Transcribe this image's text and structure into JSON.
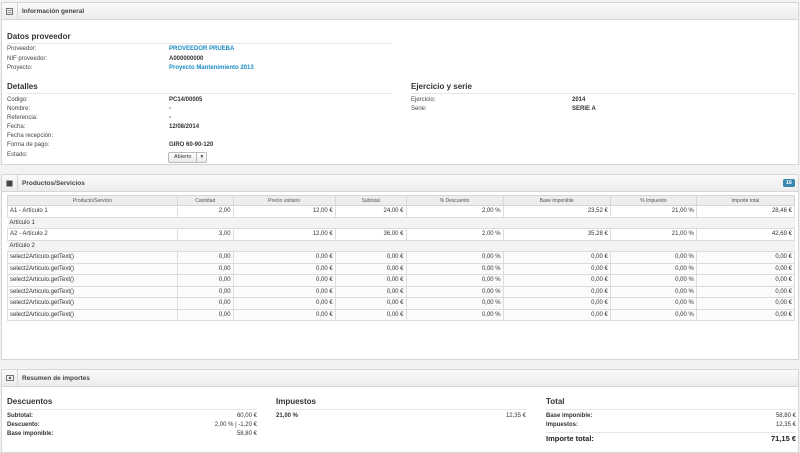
{
  "general": {
    "title": "Información general",
    "proveedor_section": "Datos proveedor",
    "proveedor_label": "Proveedor:",
    "proveedor_value": "PROVEEDOR PRUEBA",
    "nif_label": "NIF proveedor:",
    "nif_value": "A000000000",
    "proyecto_label": "Proyecto:",
    "proyecto_value": "Proyecto Mantenimiento 2013",
    "detalles_section": "Detalles",
    "codigo_label": "Codigo:",
    "codigo_value": "PC14/00005",
    "nombre_label": "Nombre:",
    "nombre_value": "-",
    "referencia_label": "Referencia:",
    "referencia_value": "-",
    "fecha_label": "Fecha:",
    "fecha_value": "12/08/2014",
    "fecha_recepcion_label": "Fecha recepción:",
    "forma_pago_label": "Forma de pago:",
    "forma_pago_value": "GIRO 60-90-120",
    "estado_label": "Estado:",
    "estado_value": "Abierto",
    "ejercicio_section": "Ejercicio y serie",
    "ejercicio_label": "Ejercicio:",
    "ejercicio_value": "2014",
    "serie_label": "Serie:",
    "serie_value": "SERIE A"
  },
  "productos": {
    "title": "Productos/Servicios",
    "badge": "16",
    "columns": [
      "Producto/Servicio",
      "Cantidad",
      "Precio unitario",
      "Subtotal",
      "% Descuento",
      "Base imponible",
      "% Impuesto",
      "Importe total"
    ],
    "rows": [
      {
        "type": "item",
        "cells": [
          "A1 - Artículo 1",
          "2,00",
          "12,00 €",
          "24,00 €",
          "2,00 %",
          "23,52 €",
          "21,00 %",
          "28,46 €"
        ]
      },
      {
        "type": "group",
        "label": "Artículo 1"
      },
      {
        "type": "item",
        "cells": [
          "A2 - Artículo 2",
          "3,00",
          "12,00 €",
          "36,00 €",
          "2,00 %",
          "35,28 €",
          "21,00 %",
          "42,69 €"
        ]
      },
      {
        "type": "group",
        "label": "Artículo 2"
      },
      {
        "type": "calc",
        "cells": [
          "select2Articulo.getText()",
          "0,00",
          "0,00 €",
          "0,00 €",
          "0,00 %",
          "0,00 €",
          "0,00 %",
          "0,00 €"
        ]
      },
      {
        "type": "calc",
        "cells": [
          "select2Articulo.getText()",
          "0,00",
          "0,00 €",
          "0,00 €",
          "0,00 %",
          "0,00 €",
          "0,00 %",
          "0,00 €"
        ]
      },
      {
        "type": "calc",
        "cells": [
          "select2Articulo.getText()",
          "0,00",
          "0,00 €",
          "0,00 €",
          "0,00 %",
          "0,00 €",
          "0,00 %",
          "0,00 €"
        ]
      },
      {
        "type": "calc",
        "cells": [
          "select2Articulo.getText()",
          "0,00",
          "0,00 €",
          "0,00 €",
          "0,00 %",
          "0,00 €",
          "0,00 %",
          "0,00 €"
        ]
      },
      {
        "type": "calc",
        "cells": [
          "select2Articulo.getText()",
          "0,00",
          "0,00 €",
          "0,00 €",
          "0,00 %",
          "0,00 €",
          "0,00 %",
          "0,00 €"
        ]
      },
      {
        "type": "calc",
        "cells": [
          "select2Articulo.getText()",
          "0,00",
          "0,00 €",
          "0,00 €",
          "0,00 %",
          "0,00 €",
          "0,00 %",
          "0,00 €"
        ]
      }
    ]
  },
  "resumen": {
    "title": "Resumen de importes",
    "descuentos_section": "Descuentos",
    "subtotal_label": "Subtotal:",
    "subtotal_value": "60,00 €",
    "descuento_label": "Descuento:",
    "descuento_value": "2,00 % | -1,20 €",
    "base_label": "Base imponible:",
    "base_value": "58,80 €",
    "impuestos_section": "Impuestos",
    "impuesto_rate": "21,00 %",
    "impuesto_amount": "12,35 €",
    "total_section": "Total",
    "total_base_label": "Base imponible:",
    "total_base_value": "58,80 €",
    "total_impuestos_label": "Impuestos:",
    "total_impuestos_value": "12,35 €",
    "importe_total_label": "Importe total:",
    "importe_total_value": "71,15 €"
  },
  "colors": {
    "link": "#1a8bc4",
    "badge": "#3a87ad"
  }
}
